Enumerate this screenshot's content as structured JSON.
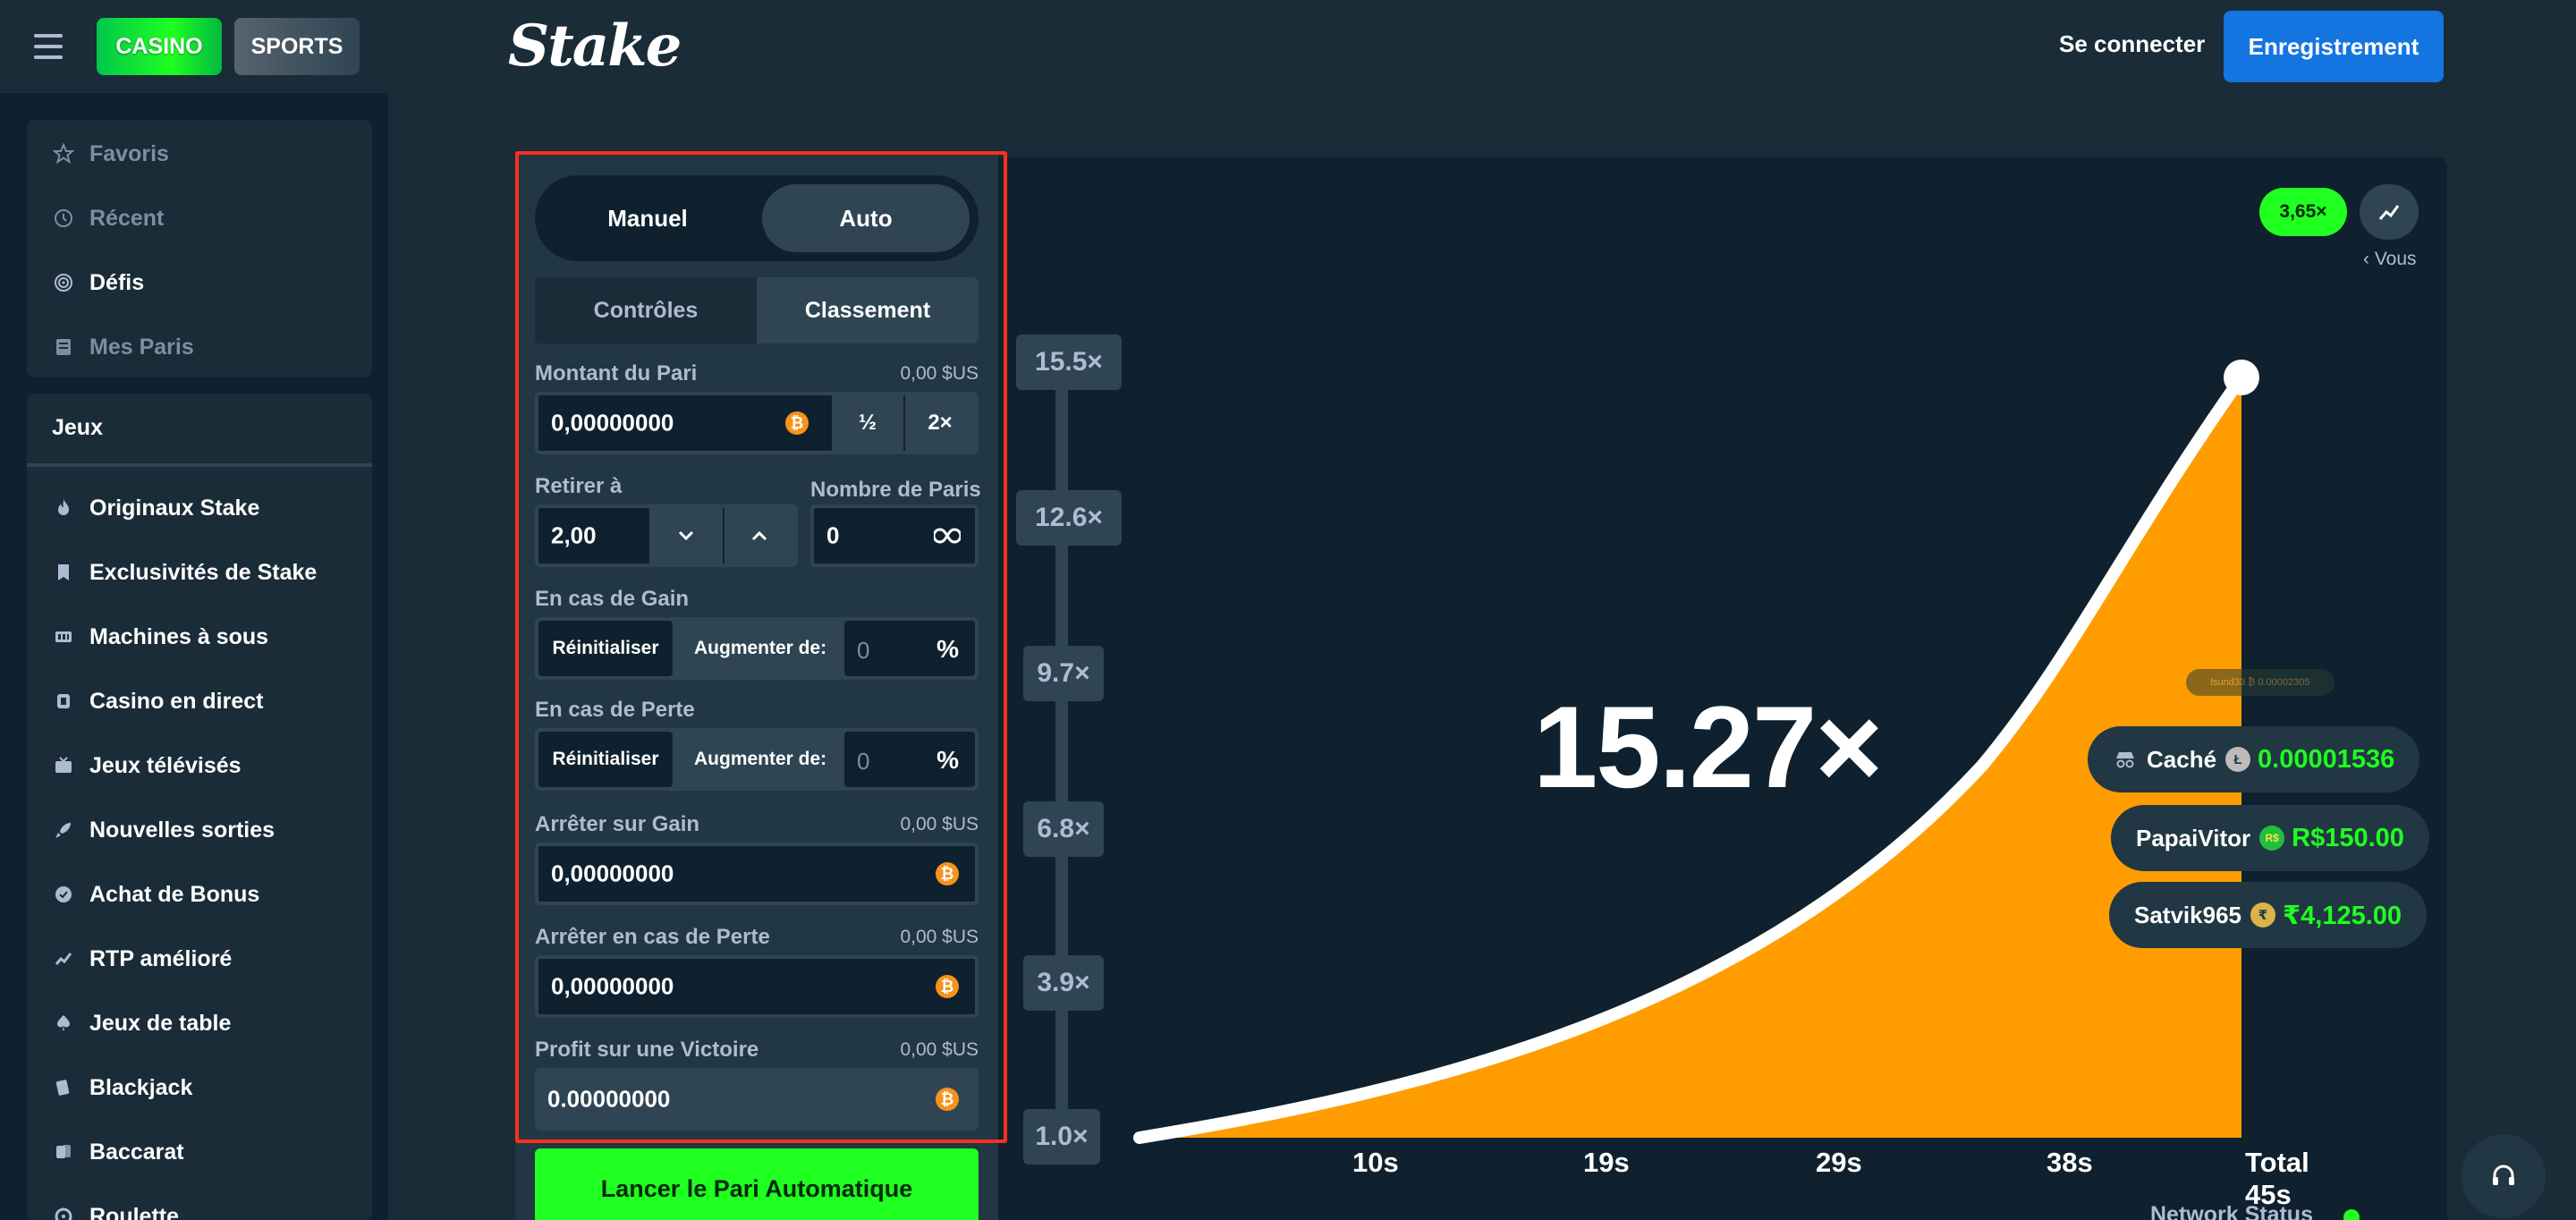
{
  "header": {
    "casino": "CASINO",
    "sports": "SPORTS",
    "logo": "Stake",
    "login": "Se connecter",
    "register": "Enregistrement"
  },
  "sidebar": {
    "top_items": [
      {
        "label": "Favoris",
        "icon": "star-icon"
      },
      {
        "label": "Récent",
        "icon": "history-icon"
      },
      {
        "label": "Défis",
        "icon": "target-icon"
      },
      {
        "label": "Mes Paris",
        "icon": "bets-icon"
      }
    ],
    "section_title": "Jeux",
    "game_items": [
      {
        "label": "Originaux Stake",
        "icon": "flame-icon"
      },
      {
        "label": "Exclusivités de Stake",
        "icon": "bookmark-icon"
      },
      {
        "label": "Machines à sous",
        "icon": "slots-icon"
      },
      {
        "label": "Casino en direct",
        "icon": "live-casino-icon"
      },
      {
        "label": "Jeux télévisés",
        "icon": "tv-icon"
      },
      {
        "label": "Nouvelles sorties",
        "icon": "rocket-icon"
      },
      {
        "label": "Achat de Bonus",
        "icon": "bonus-icon"
      },
      {
        "label": "RTP amélioré",
        "icon": "rtp-icon"
      },
      {
        "label": "Jeux de table",
        "icon": "table-games-icon"
      },
      {
        "label": "Blackjack",
        "icon": "blackjack-icon"
      },
      {
        "label": "Baccarat",
        "icon": "baccarat-icon"
      },
      {
        "label": "Roulette",
        "icon": "roulette-icon"
      }
    ]
  },
  "bet_panel": {
    "mode_manual": "Manuel",
    "mode_auto": "Auto",
    "tab_controls": "Contrôles",
    "tab_ranking": "Classement",
    "bet_amount_label": "Montant du Pari",
    "bet_amount_usd": "0,00 $US",
    "bet_amount_value": "0,00000000",
    "half": "½",
    "double": "2×",
    "cashout_label": "Retirer à",
    "cashout_value": "2,00",
    "num_bets_label": "Nombre de Paris",
    "num_bets_value": "0",
    "on_win_label": "En cas de Gain",
    "on_loss_label": "En cas de Perte",
    "reset": "Réinitialiser",
    "increase_by": "Augmenter de:",
    "percent_value": "0",
    "percent_sign": "%",
    "stop_profit_label": "Arrêter sur Gain",
    "stop_profit_usd": "0,00 $US",
    "stop_profit_value": "0,00000000",
    "stop_loss_label": "Arrêter en cas de Perte",
    "stop_loss_usd": "0,00 $US",
    "stop_loss_value": "0,00000000",
    "profit_on_win_label": "Profit sur une Victoire",
    "profit_on_win_usd": "0,00 $US",
    "profit_on_win_value": "0.00000000",
    "launch_button": "Lancer le Pari Automatique"
  },
  "game": {
    "current_multiplier": "15.27×",
    "last_multiplier_badge": "3,65×",
    "vous": "‹ Vous",
    "y_ticks": [
      "15.5×",
      "12.6×",
      "9.7×",
      "6.8×",
      "3.9×",
      "1.0×"
    ],
    "x_ticks": [
      "10s",
      "19s",
      "29s",
      "38s",
      "Total 45s"
    ],
    "tiny_pill": "lsund33 ₿ 0.00002305",
    "players": [
      {
        "name": "Caché",
        "amount": "0.00001536",
        "coin": "Ł",
        "coin_color": "#bfbbbb"
      },
      {
        "name": "PapaiVitor",
        "amount": "R$150.00",
        "coin": "R$",
        "coin_color": "#1fbf3f"
      },
      {
        "name": "Satvik965",
        "amount": "₹4,125.00",
        "coin": "₹",
        "coin_color": "#d9b44a"
      }
    ],
    "network_status": "Network Status"
  },
  "colors": {
    "accent_green": "#1fff20",
    "accent_blue": "#1475e1",
    "curve_fill": "#ff9d00",
    "highlight_border": "#ff2f1f"
  }
}
